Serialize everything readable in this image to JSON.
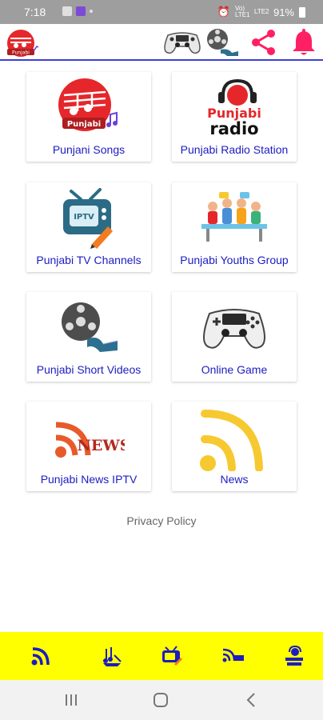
{
  "status_bar": {
    "time": "7:18",
    "battery": "91%",
    "signal_text_top": "Vo) LTE1",
    "signal_text_bottom": "LTE2"
  },
  "app_bar": {
    "logo_text": "Punjabi",
    "header_icons": [
      "gamepad-icon",
      "film-reel-icon",
      "share-icon",
      "bell-icon"
    ],
    "accent": "#ff1f63",
    "divider": "#3b3fd6"
  },
  "tiles": [
    {
      "label": "Punjani Songs",
      "icon": "punjabi-songs-icon",
      "badge": "Punjabi"
    },
    {
      "label": "Punjabi Radio Station",
      "icon": "punjabi-radio-icon",
      "badge_top": "Punjabi",
      "badge_bottom": "radio"
    },
    {
      "label": "Punjabi TV Channels",
      "icon": "iptv-icon",
      "badge": "IPTV"
    },
    {
      "label": "Punjabi Youths Group",
      "icon": "youth-group-icon"
    },
    {
      "label": "Punjabi Short Videos",
      "icon": "film-reel-icon"
    },
    {
      "label": "Online Game",
      "icon": "gamepad-icon"
    },
    {
      "label": "Punjabi News IPTV",
      "icon": "news-rss-icon",
      "badge": "NEWS"
    },
    {
      "label": "News",
      "icon": "rss-icon"
    }
  ],
  "footer": {
    "privacy_label": "Privacy Policy"
  },
  "bottom_nav": {
    "items": [
      "rss-icon",
      "song-icon",
      "tv-icon",
      "news-icon",
      "radio-icon"
    ],
    "background": "#ffff00",
    "icon_color": "#1c1cc2"
  },
  "colors": {
    "label": "#1c1cc2",
    "red": "#e5272b",
    "yellow_rss": "#f7c930"
  }
}
